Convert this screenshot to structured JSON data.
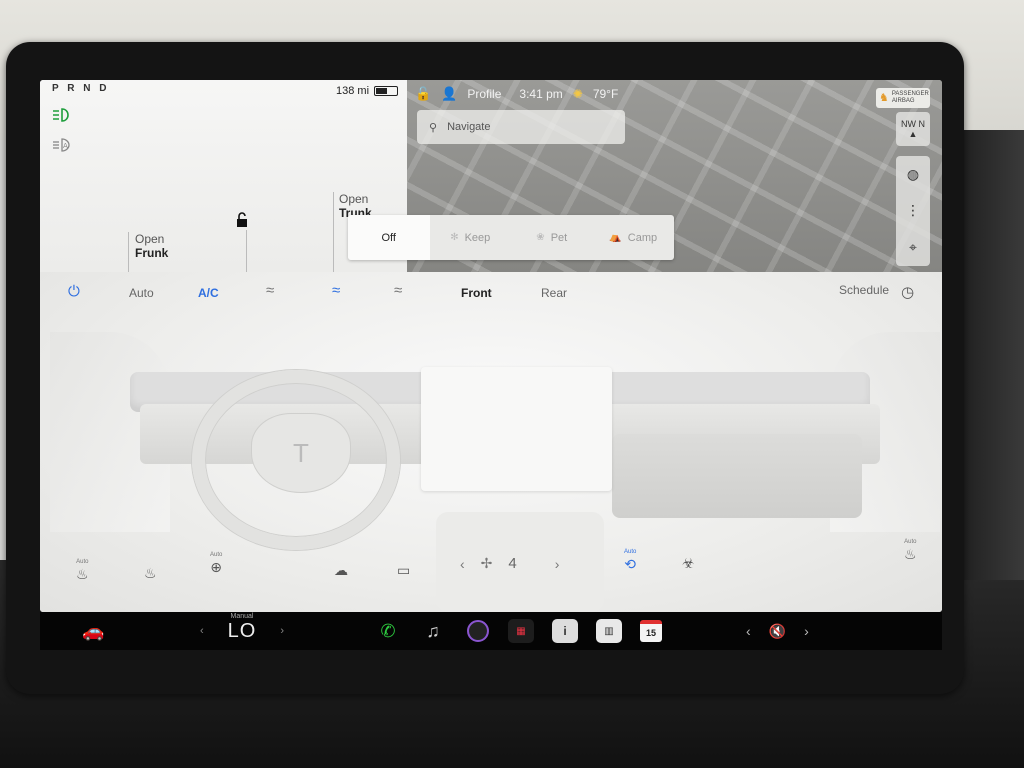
{
  "car_panel": {
    "gear": "P R N D",
    "range": "138 mi",
    "battery_level": 0.55,
    "headlights_icon": "headlight-icon",
    "auto_lights_icon": "auto-headlight-icon",
    "frunk": {
      "line1": "Open",
      "line2": "Frunk"
    },
    "trunk": {
      "line1": "Open",
      "line2": "Trunk"
    }
  },
  "status_bar": {
    "profile_label": "Profile",
    "time": "3:41 pm",
    "temperature": "79°F"
  },
  "map": {
    "navigate_placeholder": "Navigate",
    "airbag_line1": "PASSENGER",
    "airbag_line2": "AIRBAG",
    "compass_line1": "NW N",
    "compass_line2": "▲"
  },
  "keep_modes": {
    "options": [
      "Off",
      "Keep",
      "Pet",
      "Camp"
    ],
    "selected": "Off"
  },
  "climate": {
    "auto_label": "Auto",
    "ac_label": "A/C",
    "front_label": "Front",
    "rear_label": "Rear",
    "schedule_label": "Schedule",
    "fan_speed": "4",
    "seat_heat_left_label": "Auto",
    "steering_heat_label": "Auto",
    "recirc_label": "Auto",
    "seat_heat_right_label": "Auto"
  },
  "dock": {
    "temp_mode": "Manual",
    "temp_value": "LO",
    "calendar_day": "15"
  },
  "colors": {
    "accent_blue": "#2f6fe0",
    "lights_green": "#1e9e3c",
    "phone_green": "#2ecc40"
  }
}
